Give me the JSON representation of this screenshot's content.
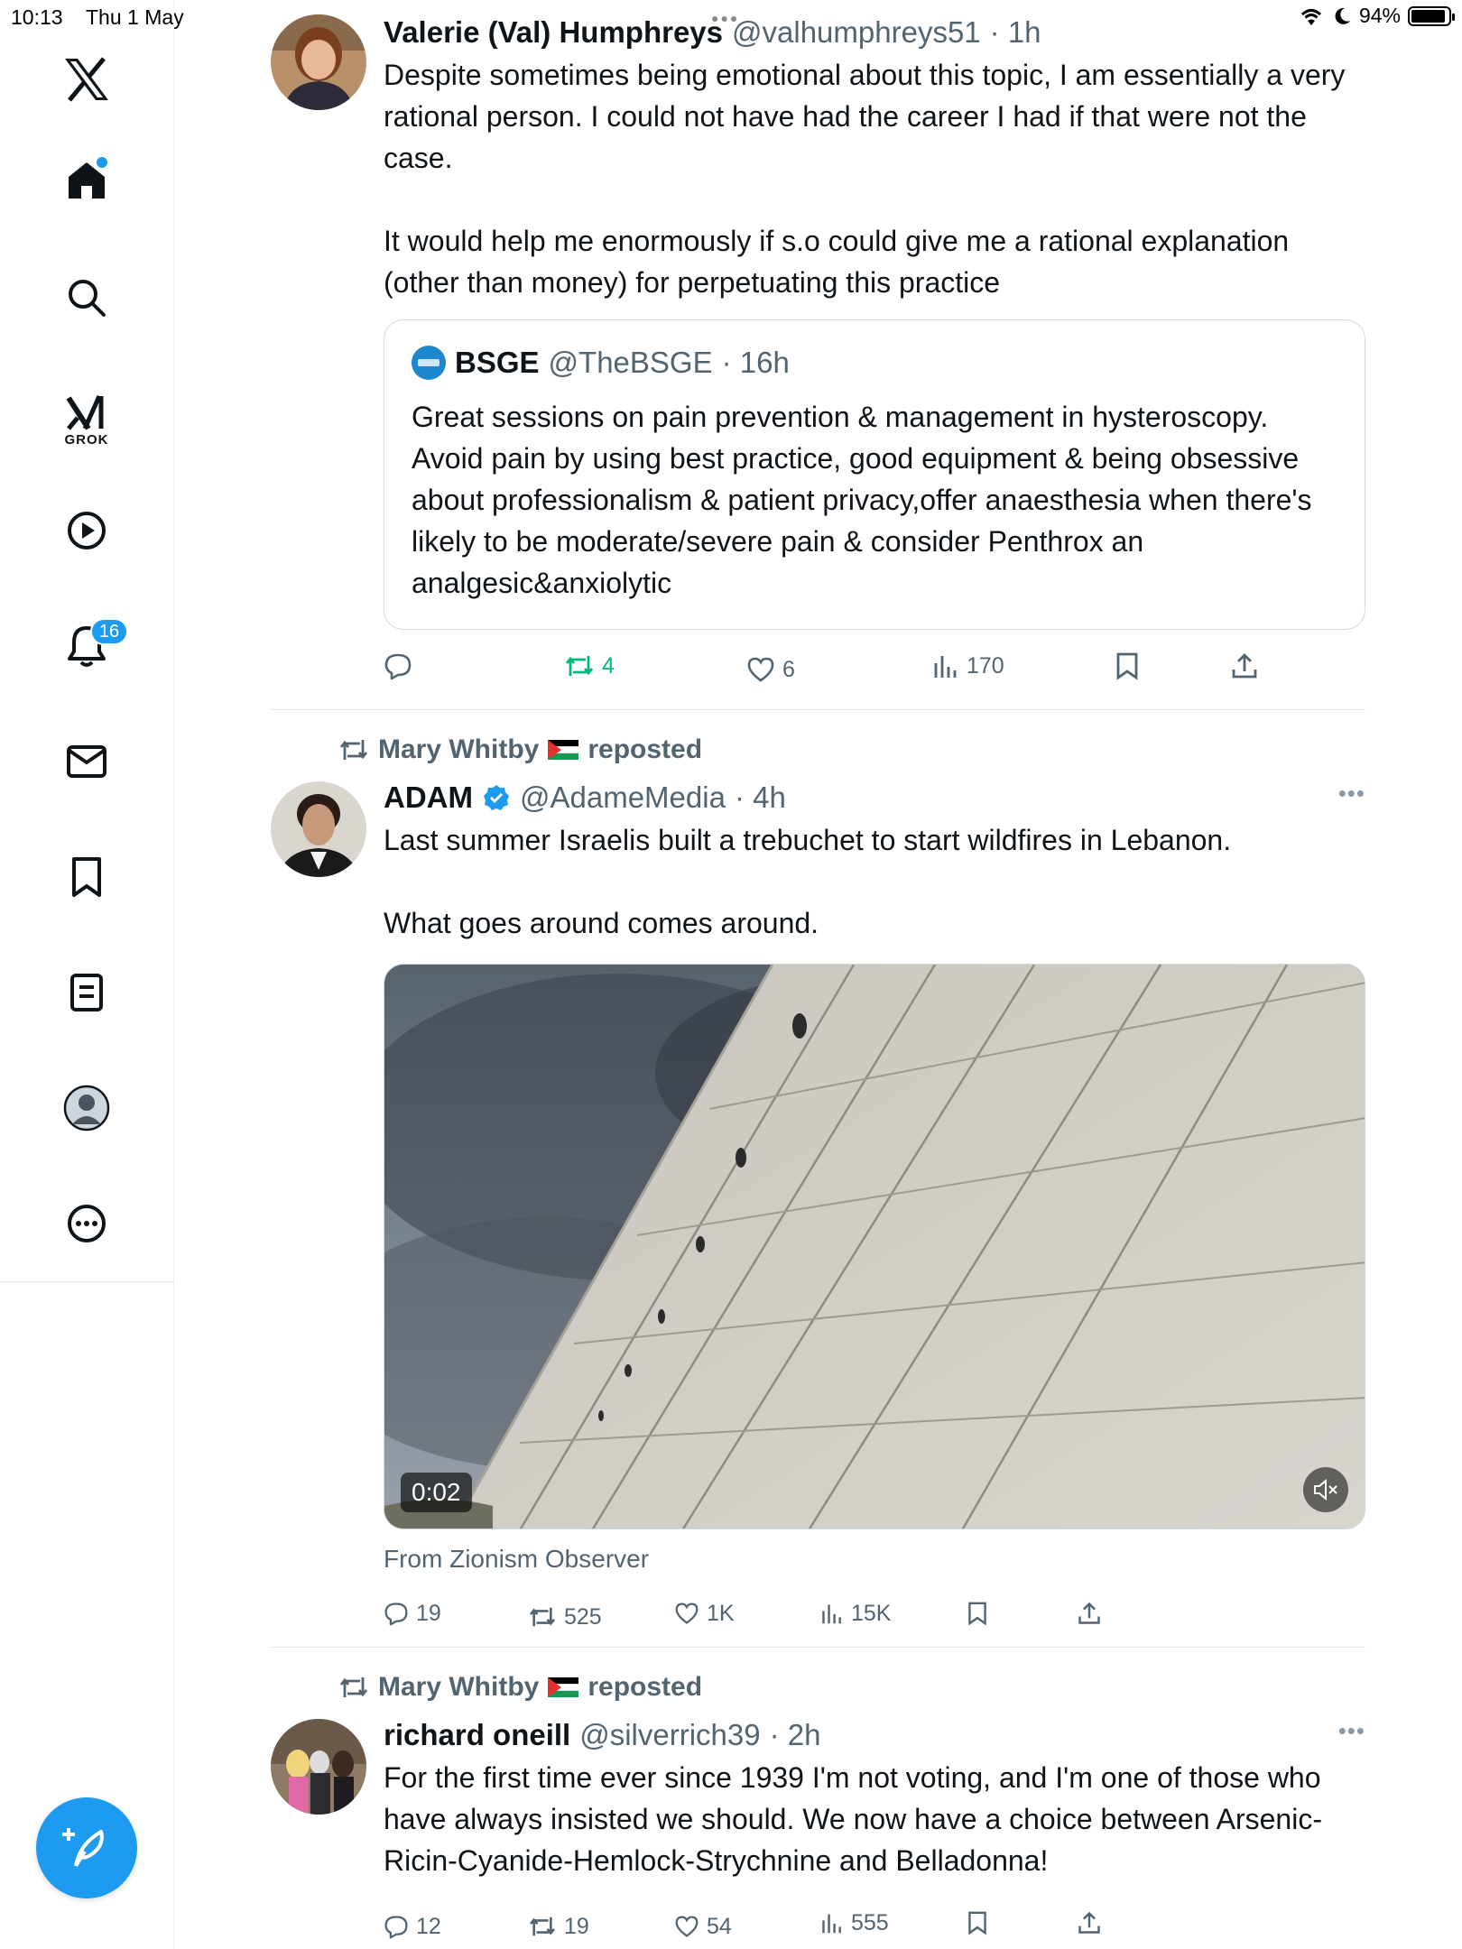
{
  "status_bar": {
    "time": "10:13",
    "date": "Thu 1 May",
    "battery": "94%"
  },
  "sidebar": {
    "items": [
      {
        "icon": "x-logo-icon"
      },
      {
        "icon": "home-icon"
      },
      {
        "icon": "search-icon"
      },
      {
        "icon": "grok-icon",
        "label": "GROK"
      },
      {
        "icon": "video-icon"
      },
      {
        "icon": "notifications-icon",
        "badge": "16"
      },
      {
        "icon": "messages-icon"
      },
      {
        "icon": "bookmarks-icon"
      },
      {
        "icon": "lists-icon"
      },
      {
        "icon": "profile-icon"
      },
      {
        "icon": "more-icon"
      }
    ],
    "compose_icon": "compose-icon"
  },
  "tweets": [
    {
      "name": "Valerie (Val) Humphreys",
      "handle": "@valhumphreys51",
      "time": "· 1h",
      "text": "Despite sometimes being emotional about this topic, I am essentially a very rational person. I could not have had the career I had if that were not the case.\n\nIt would help me enormously if s.o could give me a rational explanation (other than money) for perpetuating this practice",
      "quote": {
        "name": "BSGE",
        "handle": "@TheBSGE",
        "time": "· 16h",
        "text": "Great sessions on pain prevention & management in hysteroscopy. Avoid pain by using best practice, good equipment & being obsessive about professionalism & patient privacy,offer anaesthesia when there's likely to be moderate/severe pain & consider Penthrox an analgesic&anxiolytic"
      },
      "actions": {
        "replies": "",
        "reposts": "4",
        "likes": "6",
        "views": "170"
      }
    },
    {
      "repost_by": "Mary Whitby",
      "repost_suffix": "reposted",
      "name": "ADAM",
      "handle": "@AdameMedia",
      "time": "· 4h",
      "text": "Last summer Israelis built a trebuchet to start wildfires in Lebanon.\n\nWhat goes around comes around.",
      "media": {
        "duration": "0:02"
      },
      "from": "From Zionism Observer",
      "actions": {
        "replies": "19",
        "reposts": "525",
        "likes": "1K",
        "views": "15K"
      }
    },
    {
      "repost_by": "Mary Whitby",
      "repost_suffix": "reposted",
      "name": "richard oneill",
      "handle": "@silverrich39",
      "time": "· 2h",
      "text": "For the first time ever since 1939 I'm not voting, and I'm one of those who have always insisted we should. We now have a choice between Arsenic-Ricin-Cyanide-Hemlock-Strychnine and Belladonna!",
      "actions": {
        "replies": "12",
        "reposts": "19",
        "likes": "54",
        "views": "555"
      }
    }
  ],
  "colors": {
    "accent": "#1d9bf0",
    "repost_green": "#00ba7c",
    "secondary_text": "#536471"
  }
}
